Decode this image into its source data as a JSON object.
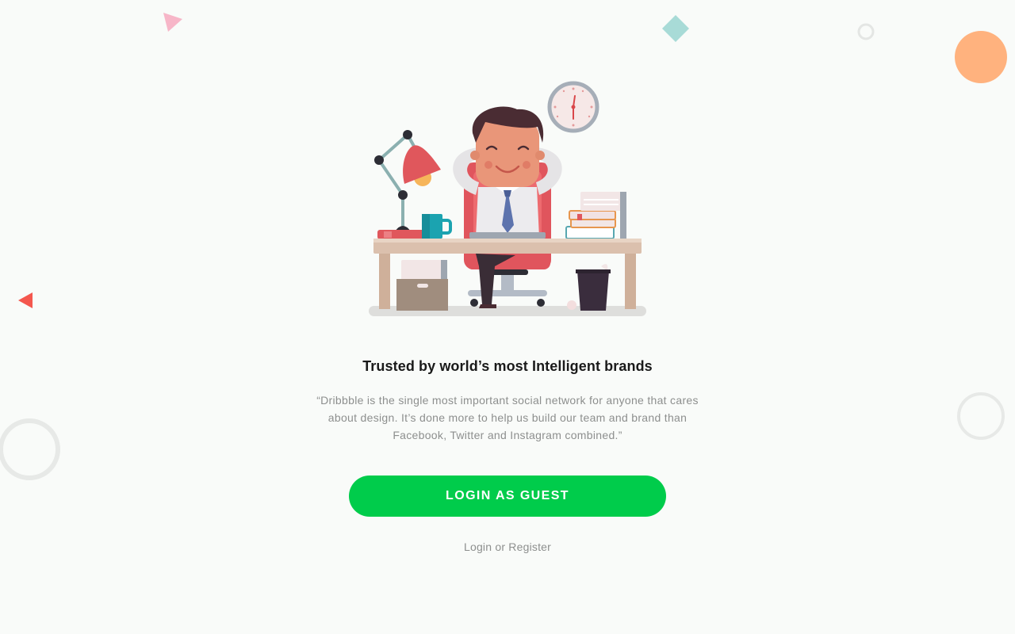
{
  "hero": {
    "illustration": "office-worker-relaxing-at-desk"
  },
  "content": {
    "headline": "Trusted by world’s most Intelligent brands",
    "quote": "“Dribbble is the single most important social network for anyone that cares about design. It’s done more to help us build our team and brand than Facebook, Twitter and Instagram combined.”"
  },
  "actions": {
    "guest_label": "LOGIN AS GUEST",
    "login_label": "Login",
    "or_label": "or",
    "register_label": "Register"
  },
  "colors": {
    "background": "#f9fbf9",
    "accent": "#00cc4b",
    "headline": "#1a1a1a",
    "muted_text": "#8d8f8e"
  }
}
